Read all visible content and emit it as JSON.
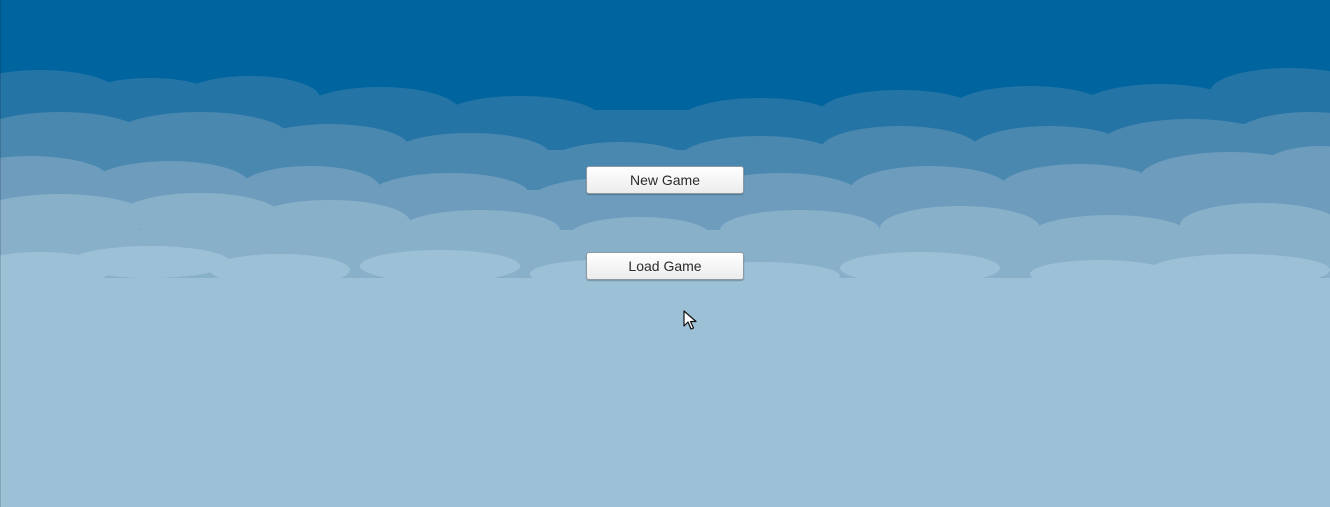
{
  "main_menu": {
    "new_game_label": "New Game",
    "load_game_label": "Load Game"
  },
  "background": {
    "sky_color": "#00659e",
    "cloud_colors": [
      "#2474a6",
      "#4a88b0",
      "#6d9cbd",
      "#88b0c9",
      "#9cc0d6"
    ]
  },
  "cursor": {
    "icon": "arrow-cursor-icon"
  }
}
